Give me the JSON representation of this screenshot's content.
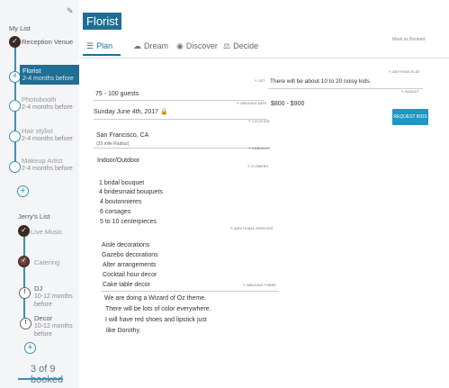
{
  "sidebar": {
    "my_list_title": "My List",
    "my_items": [
      {
        "label": "Reception Venue",
        "status": "done"
      },
      {
        "label": "Florist",
        "sub": "2-4 months before",
        "status": "active",
        "num": "4"
      },
      {
        "label": "Photobooth",
        "sub": "2-4 months before",
        "status": "open"
      },
      {
        "label": "Hair stylist",
        "sub": "2-4 months before",
        "status": "open"
      },
      {
        "label": "Makeup Artist",
        "sub": "2-4 months before",
        "status": "open"
      }
    ],
    "partner_list_title": "Jerry's List",
    "partner_items": [
      {
        "label": "Live Music",
        "status": "done"
      },
      {
        "label": "Catering",
        "status": "done"
      },
      {
        "label": "DJ",
        "sub": "10-12 months before",
        "status": "warn"
      },
      {
        "label": "Decor",
        "sub": "10-12 months before",
        "status": "warn"
      }
    ],
    "booked_summary": "3 of 9 booked"
  },
  "header": {
    "vendor_title": "Florist",
    "tabs": [
      {
        "label": "Plan",
        "icon": "list-icon"
      },
      {
        "label": "Dream",
        "icon": "cloud-icon"
      },
      {
        "label": "Discover",
        "icon": "eye-icon"
      },
      {
        "label": "Decide",
        "icon": "scale-icon"
      }
    ],
    "mark_booked": "Mark as Booked"
  },
  "details": {
    "guests": {
      "tag": "SET",
      "value": "75 - 100 guests"
    },
    "date": {
      "tag": "WEDDING DATE",
      "value": "Sunday June 4th, 2017"
    },
    "location": {
      "tag": "LOCATION",
      "value": "San Francisco, CA",
      "sub": "(25 mile Radius)"
    },
    "ambiance": {
      "tag": "AMBIANCE",
      "value": "Indoor/Outdoor"
    },
    "flowers": {
      "tag": "FLOWERS",
      "lines": [
        "1 bridal bouquet",
        "4 bridesmaid bouquets",
        "4 boutonnieres",
        "6 corsages",
        "5 to 10 centerpieces"
      ]
    },
    "services": {
      "tag": "ADDITIONAL SERVICES",
      "lines": [
        "Aisle decorations",
        "Gazebo decorations",
        "Alter arrangements",
        "Cocktail hour decor",
        "Cake table decor"
      ]
    },
    "theme": {
      "tag": "WEDDING THEME",
      "lines": [
        "We are doing a Wizard of Oz theme.",
        "There will be lots of color everywhere.",
        "I will have red shoes and lipstick just",
        "like Dorothy."
      ]
    },
    "anything_else": {
      "tag": "ANYTHING ELSE",
      "value": "There will be about 10 to 20 noisy kids."
    },
    "budget": {
      "tag": "BUDGET",
      "value": "$800 - $900"
    },
    "request_button": "REQUEST BIDS"
  }
}
